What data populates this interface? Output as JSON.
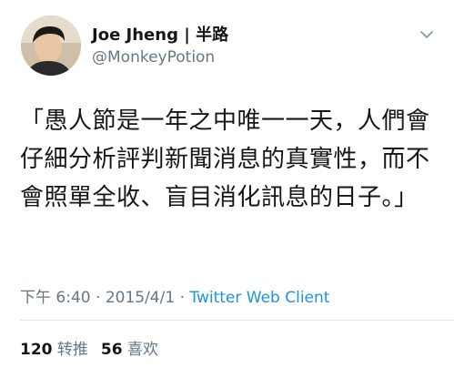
{
  "author": {
    "display_name": "Joe Jheng | 半路",
    "handle": "@MonkeyPotion"
  },
  "tweet": {
    "text": "「愚人節是一年之中唯一一天，人們會仔細分析評判新聞消息的真實性，而不會照單全收、盲目消化訊息的日子。」"
  },
  "meta": {
    "time": "下午 6:40",
    "separator": " · ",
    "date": "2015/4/1",
    "client": "Twitter Web Client"
  },
  "stats": {
    "retweets_count": "120",
    "retweets_label": "转推",
    "likes_count": "56",
    "likes_label": "喜欢"
  },
  "icons": {
    "menu": "chevron-down-icon"
  },
  "colors": {
    "link": "#1b95e0",
    "secondary": "#657786",
    "primary": "#14171a"
  }
}
